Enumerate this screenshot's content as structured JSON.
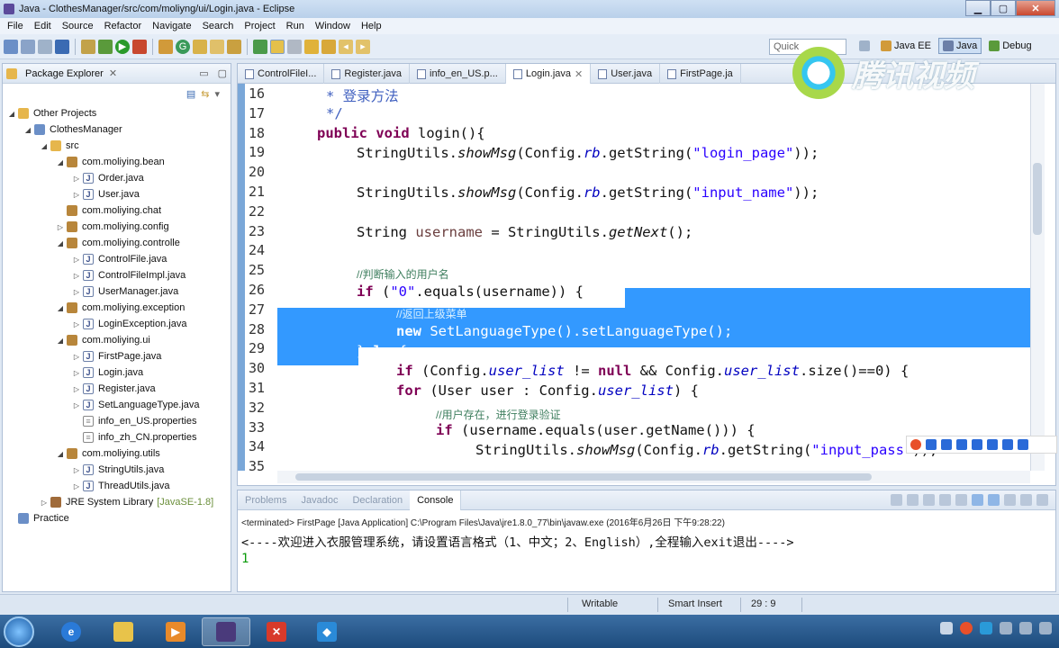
{
  "window": {
    "title": "Java - ClothesManager/src/com/moliyng/ui/Login.java - Eclipse"
  },
  "menu": [
    "File",
    "Edit",
    "Source",
    "Refactor",
    "Navigate",
    "Search",
    "Project",
    "Run",
    "Window",
    "Help"
  ],
  "toolbar": {
    "quick_access_placeholder": "Quick"
  },
  "perspectives": [
    {
      "label": "Java EE",
      "active": false
    },
    {
      "label": "Java",
      "active": true
    },
    {
      "label": "Debug",
      "active": false
    }
  ],
  "package_explorer": {
    "title": "Package Explorer",
    "tree": [
      {
        "label": "Other Projects",
        "icon": "folder",
        "depth": 0,
        "expanded": true
      },
      {
        "label": "ClothesManager",
        "icon": "proj",
        "depth": 1,
        "expanded": true
      },
      {
        "label": "src",
        "icon": "folder",
        "depth": 2,
        "expanded": true
      },
      {
        "label": "com.moliying.bean",
        "icon": "pkgi",
        "depth": 3,
        "expanded": true
      },
      {
        "label": "Order.java",
        "icon": "java",
        "depth": 4,
        "expanded": false
      },
      {
        "label": "User.java",
        "icon": "java",
        "depth": 4,
        "expanded": false
      },
      {
        "label": "com.moliying.chat",
        "icon": "pkgi",
        "depth": 3,
        "expanded": null
      },
      {
        "label": "com.moliying.config",
        "icon": "pkgi",
        "depth": 3,
        "expanded": false
      },
      {
        "label": "com.moliying.controlle",
        "icon": "pkgi",
        "depth": 3,
        "expanded": true
      },
      {
        "label": "ControlFile.java",
        "icon": "java",
        "depth": 4,
        "expanded": false
      },
      {
        "label": "ControlFileImpl.java",
        "icon": "java",
        "depth": 4,
        "expanded": false
      },
      {
        "label": "UserManager.java",
        "icon": "java",
        "depth": 4,
        "expanded": false
      },
      {
        "label": "com.moliying.exception",
        "icon": "pkgi",
        "depth": 3,
        "expanded": true
      },
      {
        "label": "LoginException.java",
        "icon": "java",
        "depth": 4,
        "expanded": false
      },
      {
        "label": "com.moliying.ui",
        "icon": "pkgi",
        "depth": 3,
        "expanded": true
      },
      {
        "label": "FirstPage.java",
        "icon": "java",
        "depth": 4,
        "expanded": false
      },
      {
        "label": "Login.java",
        "icon": "java",
        "depth": 4,
        "expanded": false
      },
      {
        "label": "Register.java",
        "icon": "java",
        "depth": 4,
        "expanded": false
      },
      {
        "label": "SetLanguageType.java",
        "icon": "java",
        "depth": 4,
        "expanded": false
      },
      {
        "label": "info_en_US.properties",
        "icon": "prop",
        "depth": 4,
        "expanded": null
      },
      {
        "label": "info_zh_CN.properties",
        "icon": "prop",
        "depth": 4,
        "expanded": null
      },
      {
        "label": "com.moliying.utils",
        "icon": "pkgi",
        "depth": 3,
        "expanded": true
      },
      {
        "label": "StringUtils.java",
        "icon": "java",
        "depth": 4,
        "expanded": false
      },
      {
        "label": "ThreadUtils.java",
        "icon": "java",
        "depth": 4,
        "expanded": false
      },
      {
        "label": "JRE System Library",
        "suffix": "[JavaSE-1.8]",
        "icon": "lib",
        "depth": 2,
        "expanded": false
      },
      {
        "label": "Practice",
        "icon": "proj",
        "depth": 0,
        "expanded": null
      }
    ]
  },
  "editor": {
    "tabs": [
      {
        "label": "ControlFileI...",
        "active": false
      },
      {
        "label": "Register.java",
        "active": false
      },
      {
        "label": "info_en_US.p...",
        "active": false
      },
      {
        "label": "Login.java",
        "active": true
      },
      {
        "label": "User.java",
        "active": false
      },
      {
        "label": "FirstPage.ja",
        "active": false
      }
    ],
    "line_numbers": [
      "16",
      "17",
      "18",
      "19",
      "20",
      "21",
      "22",
      "23",
      "24",
      "25",
      "26",
      "27",
      "28",
      "29",
      "30",
      "31",
      "32",
      "33",
      "34",
      "35"
    ],
    "code": {
      "l16": "* 登录方法",
      "l17": "*/",
      "l18_kw": "public void",
      "l18_rest": " login(){",
      "l19_a": "StringUtils.",
      "l19_b": "showMsg",
      "l19_c": "(Config.",
      "l19_d": "rb",
      "l19_e": ".getString(",
      "l19_f": "\"login_page\"",
      "l19_g": "));",
      "l21_f": "\"input_name\"",
      "l23_a": "String ",
      "l23_b": "username",
      "l23_c": " = StringUtils.",
      "l23_d": "getNext",
      "l23_e": "();",
      "l25": "//判断输入的用户名",
      "l26_kw": "if",
      "l26_a": " (",
      "l26_str": "\"0\"",
      "l26_b": ".equals(username)) {",
      "l27": "//返回上级菜单",
      "l28_kw": "new",
      "l28_rest": " SetLanguageType().setLanguageType();",
      "l29_a": "}",
      "l29_kw": "else",
      "l29_b": "{",
      "l30_kw": "if",
      "l30_a": " (Config.",
      "l30_fld": "user_list",
      "l30_b": " != ",
      "l30_kw2": "null",
      "l30_c": " && Config.",
      "l30_fld2": "user_list",
      "l30_d": ".size()==0) {",
      "l31_kw": "for",
      "l31_a": " (User user : Config.",
      "l31_fld": "user_list",
      "l31_b": ") {",
      "l32": "//用户存在，进行登录验证",
      "l33_kw": "if",
      "l33_a": " (username.equals(user.getName())) {",
      "l34_a": "StringUtils.",
      "l34_b": "showMsg",
      "l34_c": "(Config.",
      "l34_d": "rb",
      "l34_e": ".getString(",
      "l34_f": "\"input_pass\"",
      "l34_g": "));"
    }
  },
  "console": {
    "tabs": [
      {
        "label": "Problems",
        "active": false
      },
      {
        "label": "Javadoc",
        "active": false
      },
      {
        "label": "Declaration",
        "active": false
      },
      {
        "label": "Console",
        "active": true
      }
    ],
    "terminated": "<terminated> FirstPage [Java Application] C:\\Program Files\\Java\\jre1.8.0_77\\bin\\javaw.exe (2016年6月26日 下午9:28:22)",
    "line1": "<----欢迎进入衣服管理系统，请设置语言格式（1、中文；2、English）,全程输入exit退出---->",
    "line2": "1"
  },
  "statusbar": {
    "mode": "Writable",
    "insert": "Smart Insert",
    "position": "29 : 9"
  },
  "watermark": {
    "text": "腾讯视频"
  },
  "colors": {
    "selection": "#3399ff",
    "keyword": "#7f0055",
    "string": "#2a00ff",
    "comment": "#3f7f5f",
    "field": "#0000c0"
  },
  "taskbar": {
    "apps": [
      "ie-icon",
      "explorer-icon",
      "media-player-icon",
      "eclipse-icon",
      "xmind-icon",
      "app-icon"
    ]
  }
}
